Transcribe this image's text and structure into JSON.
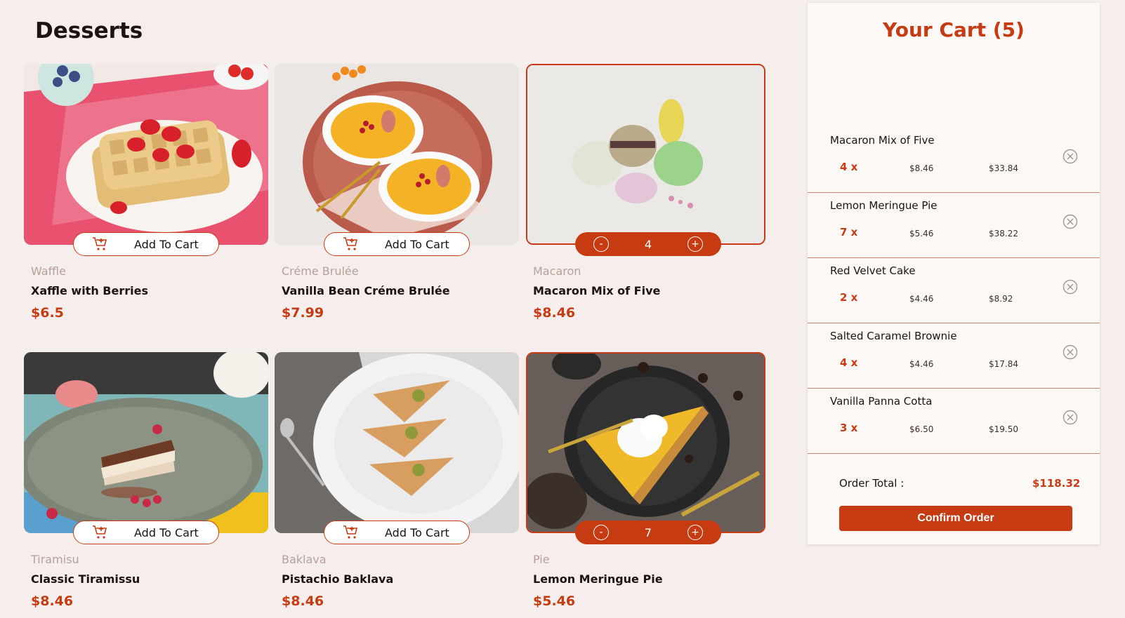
{
  "page": {
    "title": "Desserts"
  },
  "products": [
    {
      "category": "Waffle",
      "name": "Xaffle with Berries",
      "price": "$6.5",
      "in_cart": false,
      "button_label": "Add To Cart"
    },
    {
      "category": "Créme Brulée",
      "name": "Vanilla Bean Créme Brulée",
      "price": "$7.99",
      "in_cart": false,
      "button_label": "Add To Cart"
    },
    {
      "category": "Macaron",
      "name": "Macaron Mix of Five",
      "price": "$8.46",
      "in_cart": true,
      "quantity": "4",
      "decrement_label": "-",
      "increment_label": "+"
    },
    {
      "category": "Tiramisu",
      "name": "Classic Tiramissu",
      "price": "$8.46",
      "in_cart": false,
      "button_label": "Add To Cart"
    },
    {
      "category": "Baklava",
      "name": "Pistachio Baklava",
      "price": "$8.46",
      "in_cart": false,
      "button_label": "Add To Cart"
    },
    {
      "category": "Pie",
      "name": "Lemon Meringue Pie",
      "price": "$5.46",
      "in_cart": true,
      "quantity": "7",
      "decrement_label": "-",
      "increment_label": "+"
    }
  ],
  "cart": {
    "title": "Your Cart (5)",
    "items": [
      {
        "name": "Macaron Mix of Five",
        "qty": "4 x",
        "unit_price": "$8.46",
        "total": "$33.84"
      },
      {
        "name": "Lemon Meringue Pie",
        "qty": "7 x",
        "unit_price": "$5.46",
        "total": "$38.22"
      },
      {
        "name": "Red Velvet Cake",
        "qty": "2 x",
        "unit_price": "$4.46",
        "total": "$8.92"
      },
      {
        "name": "Salted Caramel Brownie",
        "qty": "4 x",
        "unit_price": "$4.46",
        "total": "$17.84"
      },
      {
        "name": "Vanilla Panna Cotta",
        "qty": "3 x",
        "unit_price": "$6.50",
        "total": "$19.50"
      }
    ],
    "order_total_label": "Order Total :",
    "order_total_value": "$118.32",
    "confirm_label": "Confirm Order"
  },
  "colors": {
    "accent": "#c73b13",
    "background": "#f5eeec",
    "panel": "#fcf8f6",
    "category_text": "#b7a19a"
  },
  "icons": {
    "add_to_cart": "cart-plus-icon",
    "remove": "circle-x-icon"
  }
}
